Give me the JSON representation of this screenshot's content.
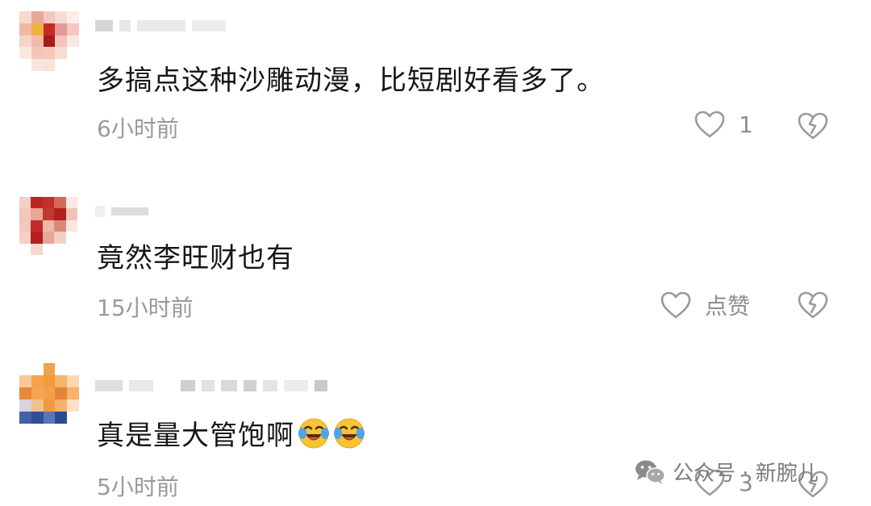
{
  "comments": [
    {
      "text": "多搞点这种沙雕动漫，比短剧好看多了。",
      "time": "6小时前",
      "like_label": "1",
      "icons": [
        "avatar",
        "heart-icon",
        "dislike-icon"
      ]
    },
    {
      "text": "竟然李旺财也有",
      "time": "15小时前",
      "like_label": "点赞",
      "icons": [
        "avatar",
        "heart-icon",
        "dislike-icon"
      ]
    },
    {
      "text": "真是量大管饱啊",
      "time": "5小时前",
      "like_label": "3",
      "emojis": [
        "crying-laughing-emoji",
        "crying-laughing-emoji"
      ],
      "icons": [
        "avatar",
        "heart-icon",
        "dislike-icon"
      ]
    }
  ],
  "watermark": {
    "text": "公众号 · 新腕儿",
    "icon": "wechat-icon"
  }
}
